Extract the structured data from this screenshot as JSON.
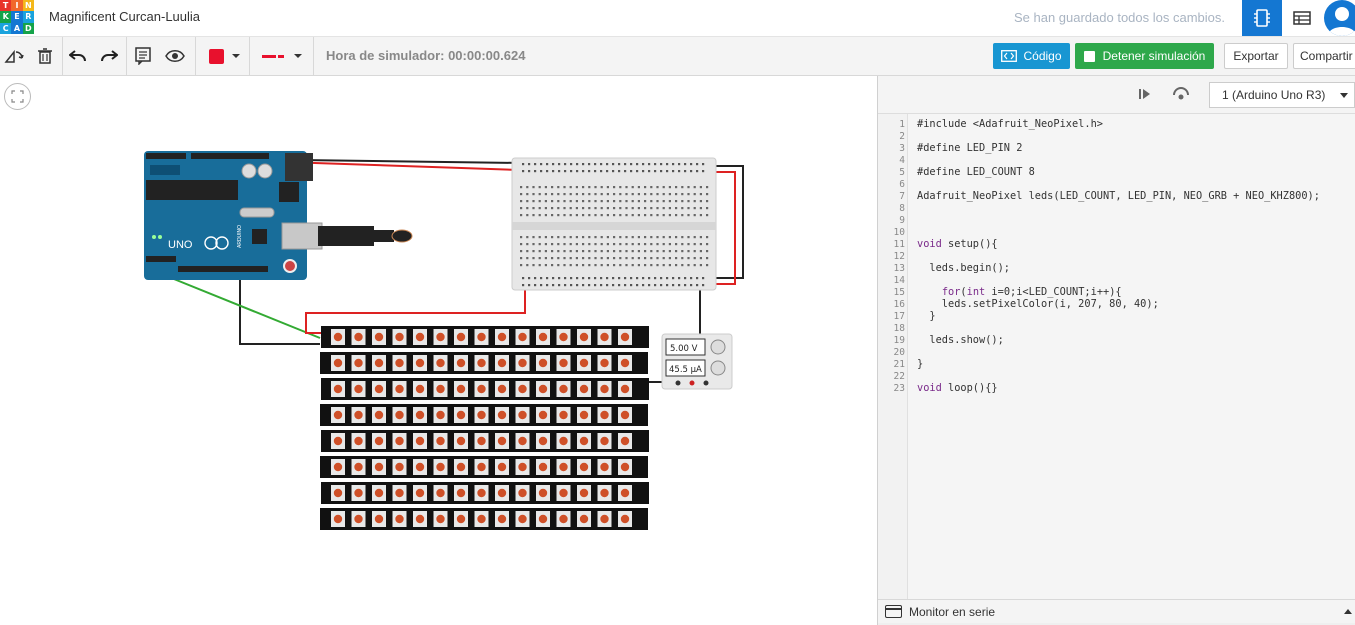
{
  "header": {
    "logo_letters": [
      "T",
      "I",
      "N",
      "K",
      "E",
      "R",
      "C",
      "A",
      "D"
    ],
    "logo_colors": [
      "#e8332a",
      "#f1682c",
      "#f4b81a",
      "#15a34a",
      "#1477d2",
      "#1aa3dd",
      "#1aa3dd",
      "#1477d2",
      "#15a34a"
    ],
    "project_title": "Magnificent Curcan-Luulia",
    "save_status": "Se han guardado todos los cambios."
  },
  "toolbar": {
    "sim_time": "Hora de simulador: 00:00:00.624",
    "code_label": "Código",
    "stop_label": "Detener simulación",
    "export_label": "Exportar",
    "share_label": "Compartir",
    "fill_color": "#e8112d",
    "line_color": "#e8112d"
  },
  "circuit": {
    "multimeter_voltage": "5.00 V",
    "multimeter_current": "45.5 μA",
    "arduino_label": "UNO",
    "arduino_brand": "ARDUINO",
    "led_rows": 8,
    "led_cols": 15,
    "led_color": "#cf5028"
  },
  "code": {
    "board": "1 (Arduino Uno R3)",
    "lines": [
      "#include <Adafruit_NeoPixel.h>",
      "",
      "#define LED_PIN 2",
      "",
      "#define LED_COUNT 8",
      "",
      "Adafruit_NeoPixel leds(LED_COUNT, LED_PIN, NEO_GRB + NEO_KHZ800);",
      "",
      "",
      "",
      "void setup(){",
      "",
      "  leds.begin();",
      "",
      "    for(int i=0;i<LED_COUNT;i++){",
      "    leds.setPixelColor(i, 207, 80, 40);",
      "  }",
      "",
      "  leds.show();",
      "",
      "}",
      "",
      "void loop(){}"
    ],
    "serial_monitor": "Monitor en serie"
  }
}
